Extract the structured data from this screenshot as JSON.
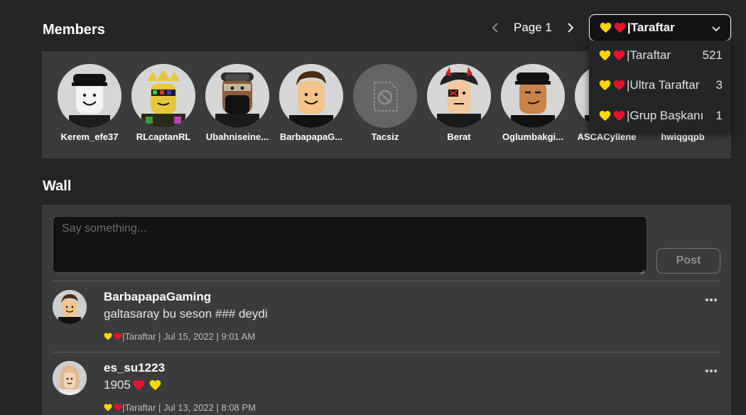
{
  "members_section": {
    "title": "Members",
    "page_label": "Page 1",
    "selected_rank": "|Taraftar",
    "members": [
      {
        "name": "Kerem_efe37"
      },
      {
        "name": "RLcaptanRL"
      },
      {
        "name": "Ubahniseine..."
      },
      {
        "name": "BarbapapaG..."
      },
      {
        "name": "Tacsiz"
      },
      {
        "name": "Berat"
      },
      {
        "name": "Oglumbakgi..."
      },
      {
        "name": "ASCACyllene"
      },
      {
        "name": "hwiqgqpb"
      }
    ]
  },
  "rank_dropdown": {
    "items": [
      {
        "label": "|Taraftar",
        "count": "521"
      },
      {
        "label": "|Ultra Taraftar",
        "count": "3"
      },
      {
        "label": "|Grup Başkanı",
        "count": "1"
      }
    ]
  },
  "wall": {
    "title": "Wall",
    "input_placeholder": "Say something...",
    "post_button": "Post",
    "posts": [
      {
        "author": "BarbapapaGaming",
        "text": "galtasaray bu seson ### deydi",
        "emoji_suffix": "",
        "meta": "|Taraftar | Jul 15, 2022 | 9:01 AM"
      },
      {
        "author": "es_su1223",
        "text": "1905",
        "emoji_suffix": "❤💛",
        "meta": "|Taraftar | Jul 13, 2022 | 8:08 PM"
      }
    ]
  },
  "colors": {
    "heart_yellow": "#ffd700",
    "heart_red": "#e8112d",
    "background": "#232527",
    "panel": "#393b3d"
  }
}
